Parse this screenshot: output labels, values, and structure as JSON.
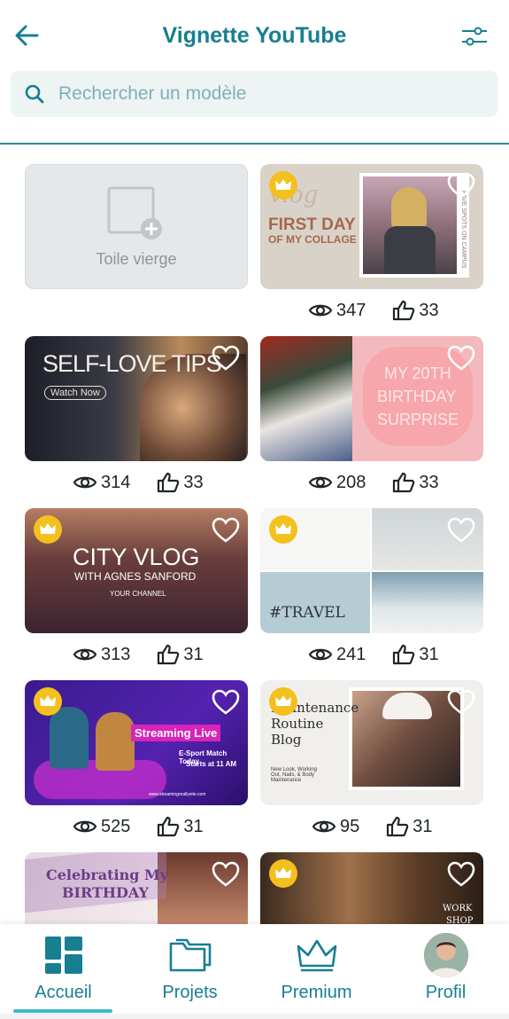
{
  "header": {
    "title": "Vignette YouTube",
    "back_icon": "arrow-left-icon",
    "filter_icon": "sliders-icon"
  },
  "search": {
    "placeholder": "Rechercher un modèle",
    "icon": "search-icon"
  },
  "blank_canvas": {
    "label": "Toile vierge"
  },
  "templates": [
    {
      "premium": true,
      "views": "347",
      "likes": "33",
      "text": [
        "vlog",
        "FIRST DAY",
        "OF MY COLLAGE",
        "FAVE SPOTS ON CAMPUS"
      ]
    },
    {
      "premium": false,
      "views": "314",
      "likes": "33",
      "text": [
        "SELF-LOVE TIPS",
        "Watch Now"
      ]
    },
    {
      "premium": false,
      "views": "208",
      "likes": "33",
      "text": [
        "MY 20TH",
        "BIRTHDAY",
        "SURPRISE"
      ]
    },
    {
      "premium": true,
      "views": "313",
      "likes": "31",
      "text": [
        "CITY VLOG",
        "WITH AGNES SANFORD",
        "YOUR CHANNEL"
      ]
    },
    {
      "premium": true,
      "views": "241",
      "likes": "31",
      "text": [
        "#TRAVEL"
      ]
    },
    {
      "premium": true,
      "views": "525",
      "likes": "31",
      "text": [
        "Streaming Live",
        "E-Sport Match Today",
        "Starts at 11 AM",
        "www.streamingreallysite.com"
      ]
    },
    {
      "premium": true,
      "views": "95",
      "likes": "31",
      "text": [
        "Maintenance",
        "Routine",
        "Blog",
        "New Look, Working Out, Nails, & Body Maintenance"
      ]
    },
    {
      "premium": false,
      "views": "",
      "likes": "",
      "text": [
        "Celebrating My",
        "BIRTHDAY"
      ]
    },
    {
      "premium": true,
      "views": "",
      "likes": "",
      "text": [
        "WORK",
        "SHOP"
      ]
    }
  ],
  "nav": {
    "items": [
      {
        "label": "Accueil",
        "icon": "dashboard-icon",
        "active": true
      },
      {
        "label": "Projets",
        "icon": "folder-icon",
        "active": false
      },
      {
        "label": "Premium",
        "icon": "crown-icon",
        "active": false
      },
      {
        "label": "Profil",
        "icon": "avatar-icon",
        "active": false
      }
    ]
  },
  "colors": {
    "accent": "#177f91",
    "indicator": "#3db7d2",
    "crown": "#f3c01d"
  }
}
